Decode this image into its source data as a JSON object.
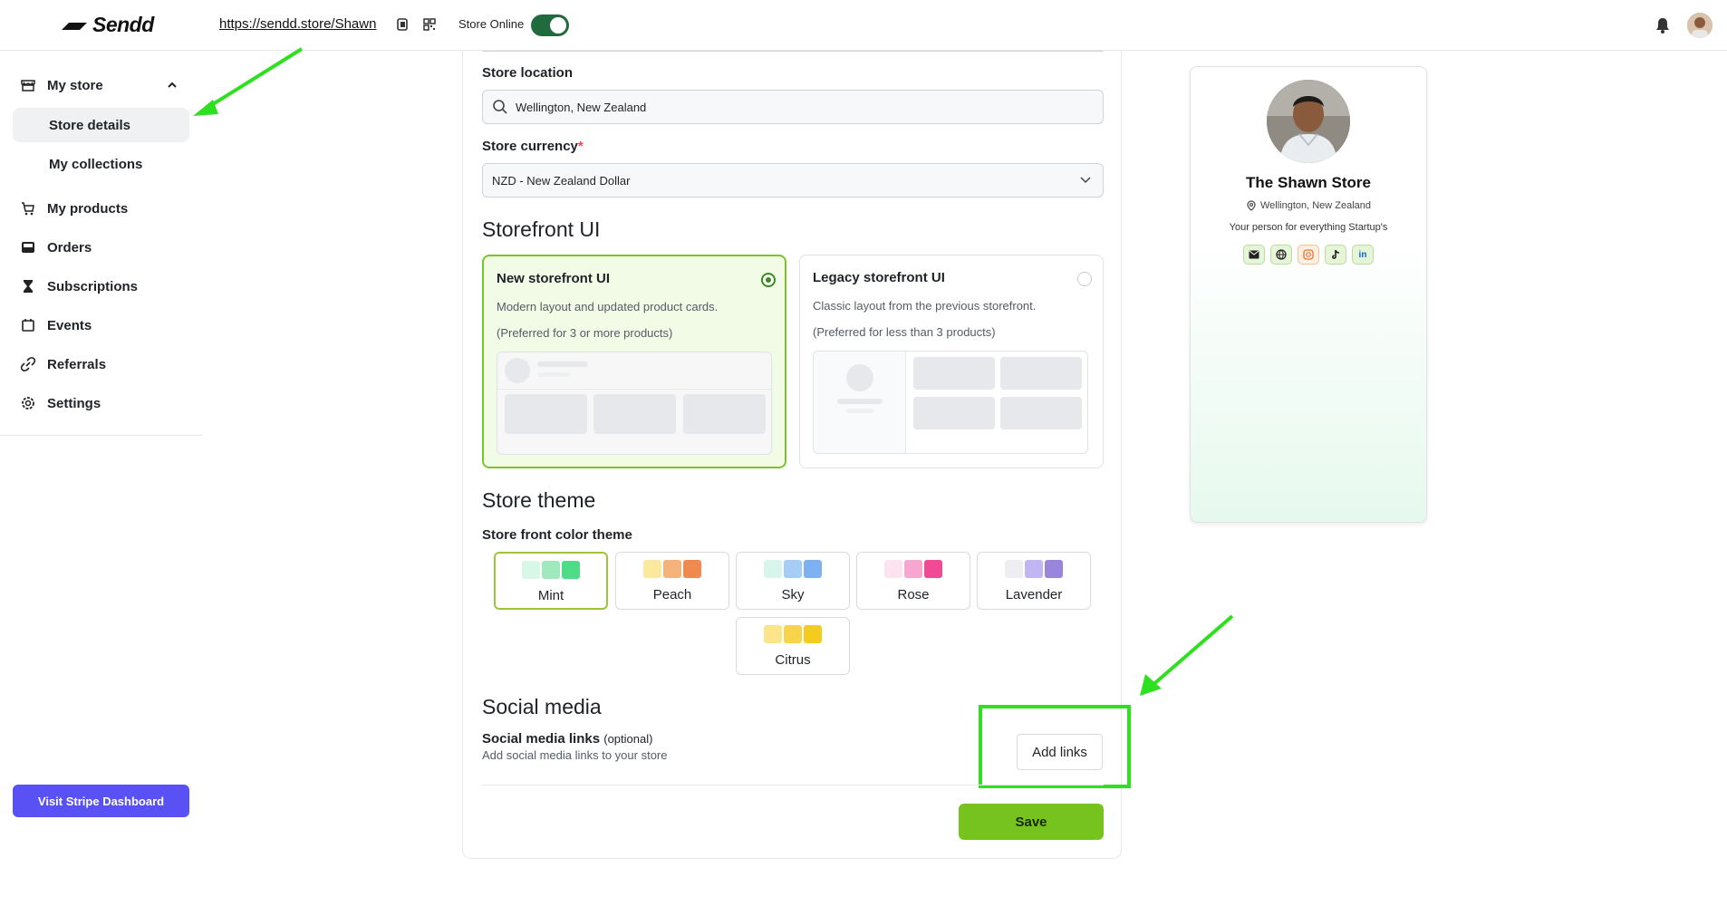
{
  "topbar": {
    "logo": "Sendd",
    "store_url": "https://sendd.store/Shawn",
    "store_online_label": "Store Online",
    "store_online": true
  },
  "sidebar": {
    "my_store": "My store",
    "store_details": "Store details",
    "my_collections": "My collections",
    "my_products": "My products",
    "orders": "Orders",
    "subscriptions": "Subscriptions",
    "events": "Events",
    "referrals": "Referrals",
    "settings": "Settings",
    "stripe_button": "Visit Stripe Dashboard"
  },
  "form": {
    "store_location_label": "Store location",
    "store_location_value": "Wellington, New Zealand",
    "store_currency_label": "Store currency",
    "required_mark": "*",
    "store_currency_value": "NZD - New Zealand Dollar",
    "storefront_heading": "Storefront UI",
    "new_ui": {
      "title": "New storefront UI",
      "desc": "Modern layout and updated product cards.",
      "pref": "(Preferred for 3 or more products)"
    },
    "legacy_ui": {
      "title": "Legacy storefront UI",
      "desc": "Classic layout from the previous storefront.",
      "pref": "(Preferred for less than 3 products)"
    },
    "theme_heading": "Store theme",
    "theme_label": "Store front color theme",
    "themes": [
      {
        "name": "Mint",
        "colors": [
          "#d9f7e6",
          "#9fe9bd",
          "#4fdc87"
        ]
      },
      {
        "name": "Peach",
        "colors": [
          "#fde8a0",
          "#f5b27a",
          "#f08a4f"
        ]
      },
      {
        "name": "Sky",
        "colors": [
          "#d8f5ec",
          "#a6cdf5",
          "#7cb1f2"
        ]
      },
      {
        "name": "Rose",
        "colors": [
          "#fde3ef",
          "#f6a6cf",
          "#ef4a93"
        ]
      },
      {
        "name": "Lavender",
        "colors": [
          "#eeeef2",
          "#c2b5f3",
          "#9a85dd"
        ]
      },
      {
        "name": "Citrus",
        "colors": [
          "#fbe58a",
          "#f8d44a",
          "#f4cb1f"
        ]
      }
    ],
    "selected_theme": "Mint",
    "social_heading": "Social media",
    "social_label": "Social media links",
    "social_optional": "(optional)",
    "social_desc": "Add social media links to your store",
    "add_links": "Add links",
    "save": "Save"
  },
  "preview_card": {
    "name": "The Shawn Store",
    "location": "Wellington, New Zealand",
    "tagline": "Your person for everything Startup's",
    "socials": [
      "mail-icon",
      "globe-icon",
      "instagram-icon",
      "tiktok-icon",
      "linkedin-icon"
    ],
    "linkedin_text": "in"
  },
  "colors": {
    "accent_green": "#76c21e",
    "stripe_purple": "#5a51f5",
    "highlight_green": "#2fe021"
  }
}
